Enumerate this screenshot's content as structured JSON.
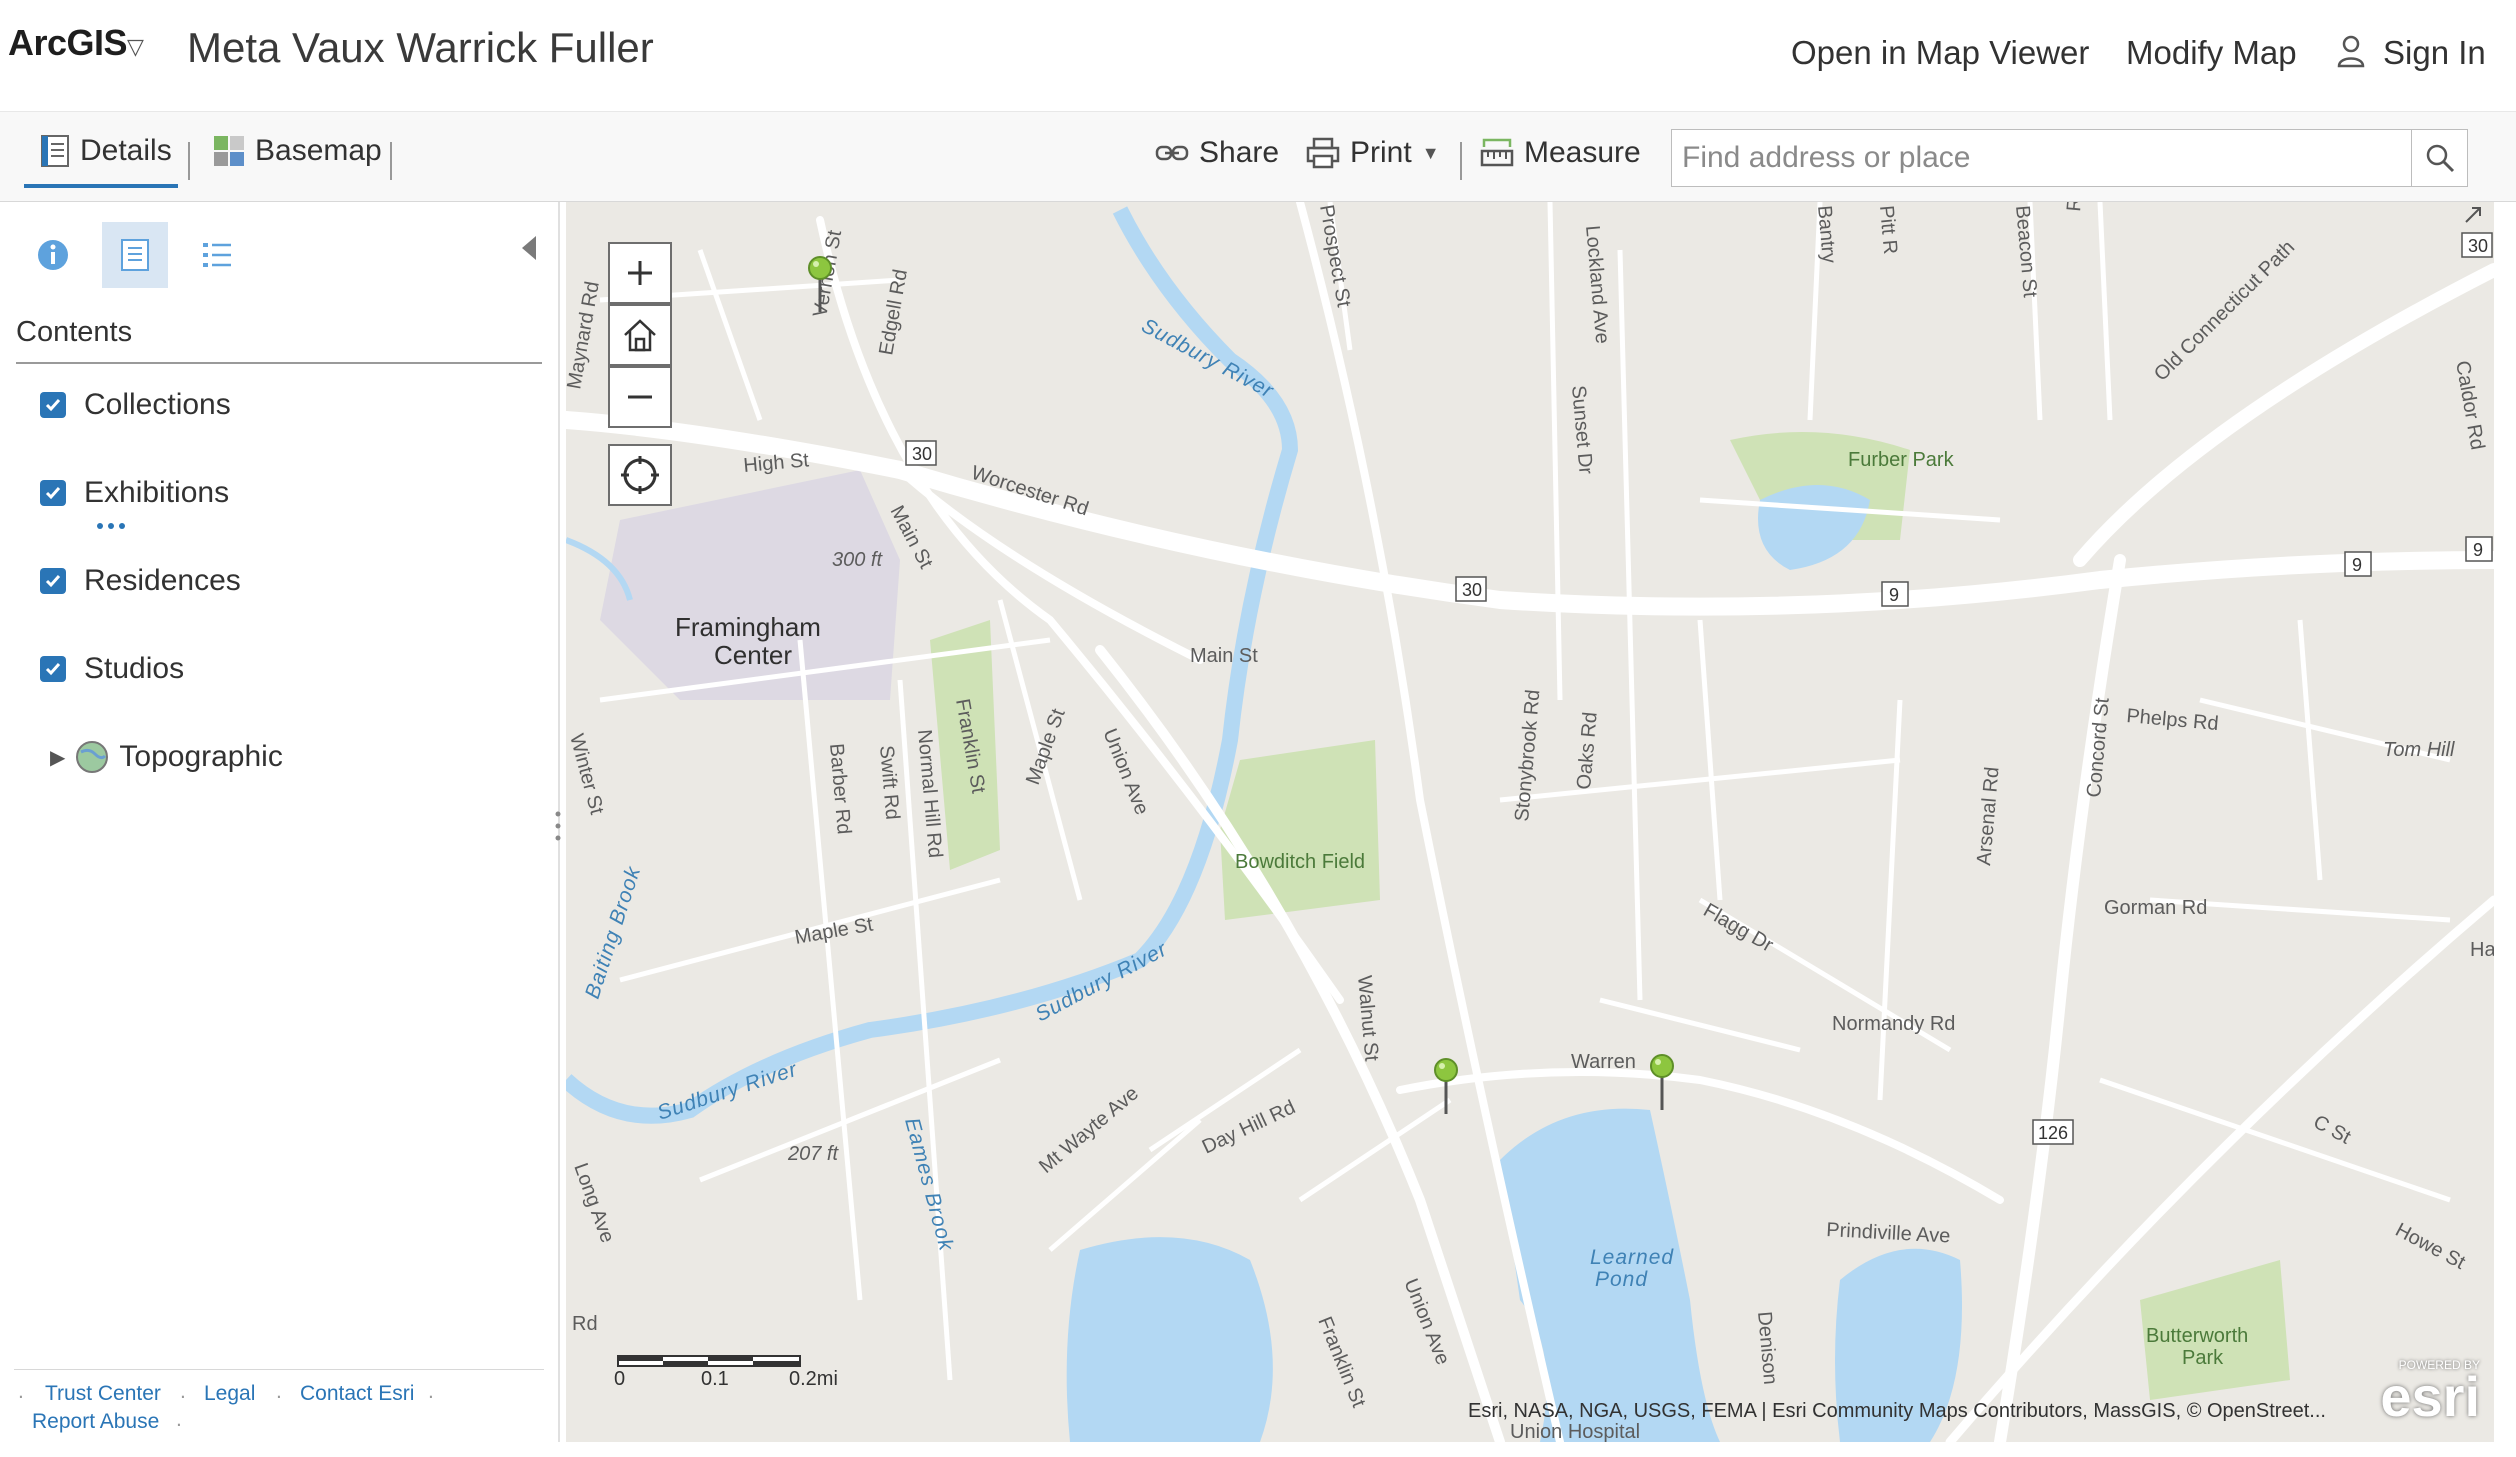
{
  "header": {
    "app_name": "ArcGIS",
    "map_title": "Meta Vaux Warrick Fuller",
    "open_in_map_viewer": "Open in Map Viewer",
    "modify_map": "Modify Map",
    "sign_in": "Sign In"
  },
  "toolbar": {
    "details": "Details",
    "basemap": "Basemap",
    "share": "Share",
    "print": "Print",
    "measure": "Measure"
  },
  "search": {
    "placeholder": "Find address or place"
  },
  "sidebar": {
    "contents_title": "Contents",
    "layers": [
      {
        "label": "Collections",
        "checked": true
      },
      {
        "label": "Exhibitions",
        "checked": true
      },
      {
        "label": "Residences",
        "checked": true
      },
      {
        "label": "Studios",
        "checked": true
      },
      {
        "label": "Topographic",
        "checked": false
      }
    ],
    "footer": {
      "trust_center": "Trust Center",
      "legal": "Legal",
      "contact_esri": "Contact Esri",
      "report_abuse": "Report Abuse"
    }
  },
  "map": {
    "places": [
      "Framingham",
      "Center"
    ],
    "parks": [
      "Furber Park",
      "Bowditch Field",
      "Butterworth",
      "Park"
    ],
    "water": [
      "Sudbury River",
      "Learned",
      "Pond",
      "Eames Brook",
      "Baiting Brook"
    ],
    "elevations": [
      "300 ft",
      "207 ft"
    ],
    "streets": [
      "Vernon St",
      "Edgell Rd",
      "High St",
      "Worcester Rd",
      "Main St",
      "Maynard Rd",
      "Prospect St",
      "Lockland Ave",
      "Sunset Dr",
      "Bantry",
      "Pitt R",
      "Beacon St",
      "Royce Rd",
      "Old Connecticut Path",
      "Caldor Rd",
      "Stonybrook Rd",
      "Oaks Rd",
      "Arsenal Rd",
      "Concord St",
      "Phelps Rd",
      "Tom Hill",
      "Gorman Rd",
      "Flagg Dr",
      "Normandy Rd",
      "Warren",
      "Prindiville Ave",
      "C St",
      "Howe St",
      "Walnut St",
      "Union Ave",
      "Franklin St",
      "Maple St",
      "Swift Rd",
      "Normal Hill Rd",
      "Barber Rd",
      "Winter St",
      "Mt Wayte Ave",
      "Day Hill Rd",
      "Long Ave",
      "Denison",
      "Union Hospital",
      "Ha",
      "Rd"
    ],
    "route_shields": [
      "30",
      "30",
      "30",
      "9",
      "9",
      "9",
      "126",
      "30"
    ],
    "scale_labels": [
      "0",
      "0.1",
      "0.2mi"
    ],
    "attribution": "Esri, NASA, NGA, USGS, FEMA | Esri Community Maps Contributors, MassGIS, © OpenStreet...",
    "esri_powered": "POWERED BY",
    "esri_brand": "esri",
    "pin_color": "#8dc63f",
    "water_color": "#b3d8f3",
    "park_color": "#cfe2b6"
  }
}
